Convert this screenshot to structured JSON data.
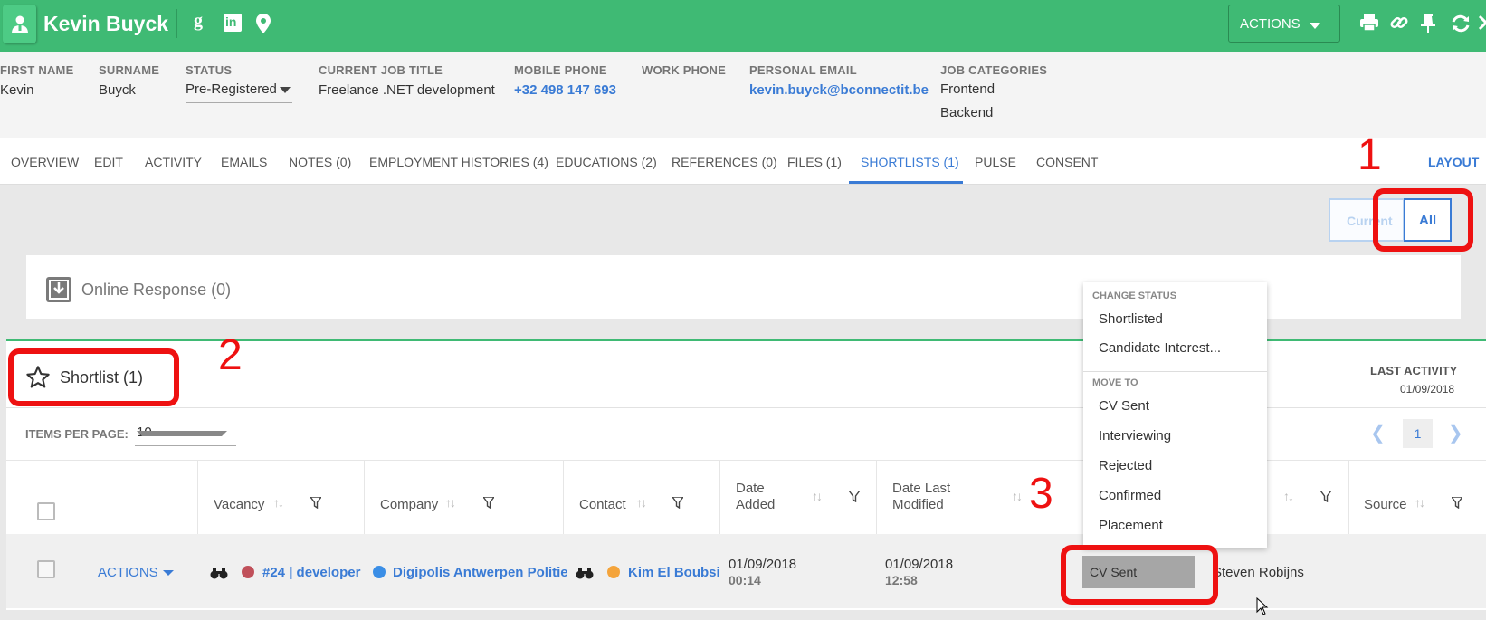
{
  "header": {
    "name": "Kevin Buyck",
    "google_glyph": "g",
    "linkedin_glyph": "in",
    "actions_label": "ACTIONS",
    "colors": {
      "brand_green": "#3fba74",
      "link_blue": "#3a7bd5",
      "annotation_red": "#ee1111"
    }
  },
  "candidate": {
    "first_name_label": "FIRST NAME",
    "first_name": "Kevin",
    "surname_label": "SURNAME",
    "surname": "Buyck",
    "status_label": "STATUS",
    "status": "Pre-Registered",
    "job_title_label": "CURRENT JOB TITLE",
    "job_title": "Freelance .NET development",
    "mobile_label": "MOBILE PHONE",
    "mobile": "+32 498 147 693",
    "work_label": "WORK PHONE",
    "email_label": "PERSONAL EMAIL",
    "email": "kevin.buyck@bconnectit.be",
    "categories_label": "JOB CATEGORIES",
    "categories": [
      "Frontend",
      "Backend"
    ]
  },
  "tabs": [
    "OVERVIEW",
    "EDIT",
    "ACTIVITY",
    "EMAILS",
    "NOTES (0)",
    "EMPLOYMENT HISTORIES (4)",
    "EDUCATIONS (2)",
    "REFERENCES (0)",
    "FILES (1)",
    "SHORTLISTS (1)",
    "PULSE",
    "CONSENT"
  ],
  "active_tab": "SHORTLISTS (1)",
  "layout_label": "LAYOUT",
  "toggle": {
    "current": "Current",
    "all": "All"
  },
  "online_response": {
    "label": "Online Response (0)"
  },
  "shortlist": {
    "title": "Shortlist (1)",
    "last_activity_label": "LAST ACTIVITY",
    "last_activity_value": "01/09/2018",
    "items_per_page_label": "ITEMS PER PAGE:",
    "items_per_page": "10",
    "page": "1",
    "columns": {
      "vacancy": "Vacancy",
      "company": "Company",
      "contact": "Contact",
      "date_added": [
        "Date",
        "Added"
      ],
      "date_modified": [
        "Date Last",
        "Modified"
      ],
      "source": "Source"
    },
    "row": {
      "actions": "ACTIONS",
      "vacancy": "#24 | developer",
      "company": "Digipolis Antwerpen Politie",
      "contact": "Kim El Boubsi",
      "date_added": "01/09/2018",
      "time_added": "00:14",
      "date_modified": "01/09/2018",
      "time_modified": "12:58",
      "status": "CV Sent",
      "owner": "Steven Robijns"
    }
  },
  "menu": {
    "change_status_label": "CHANGE STATUS",
    "change_status_items": [
      "Shortlisted",
      "Candidate Interest..."
    ],
    "move_to_label": "MOVE TO",
    "move_to_items": [
      "CV Sent",
      "Interviewing",
      "Rejected",
      "Confirmed",
      "Placement"
    ]
  },
  "annotations": [
    "1",
    "2",
    "3"
  ]
}
